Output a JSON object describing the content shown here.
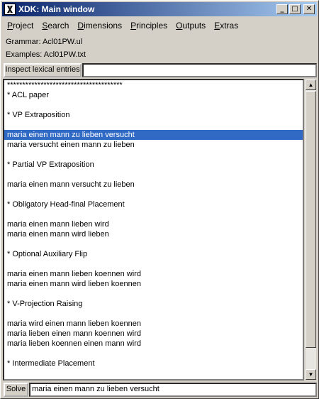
{
  "window": {
    "title": "XDK: Main window"
  },
  "titlebar_buttons": {
    "minimize": "_",
    "maximize": "□",
    "close": "✕"
  },
  "menu": [
    {
      "underline": "P",
      "rest": "roject"
    },
    {
      "underline": "S",
      "rest": "earch"
    },
    {
      "underline": "D",
      "rest": "imensions"
    },
    {
      "underline": "P",
      "rest": "rinciples"
    },
    {
      "underline": "O",
      "rest": "utputs"
    },
    {
      "underline": "E",
      "rest": "xtras"
    }
  ],
  "grammar_label": "Grammar: Acl01PW.ul",
  "examples_label": "Examples: Acl01PW.txt",
  "inspect_button": "Inspect lexical entries",
  "inspect_input": "",
  "list": {
    "lines": [
      "**************************************",
      "* ACL paper",
      "",
      "* VP Extraposition",
      "",
      "maria einen mann zu lieben versucht",
      "maria versucht einen mann zu lieben",
      "",
      "* Partial VP Extraposition",
      "",
      "maria einen mann versucht zu lieben",
      "",
      "* Obligatory Head-final Placement",
      "",
      "maria einen mann lieben wird",
      "maria einen mann wird lieben",
      "",
      "* Optional Auxiliary Flip",
      "",
      "maria einen mann lieben koennen wird",
      "maria einen mann wird lieben koennen",
      "",
      "* V-Projection Raising",
      "",
      "maria wird einen mann lieben koennen",
      "maria lieben einen mann koennen wird",
      "maria lieben koennen einen mann wird",
      "",
      "* Intermediate Placement",
      ""
    ],
    "selected_index": 5
  },
  "solve_button": "Solve",
  "solve_input": "maria einen mann zu lieben versucht",
  "scroll": {
    "up": "▲",
    "down": "▼"
  }
}
